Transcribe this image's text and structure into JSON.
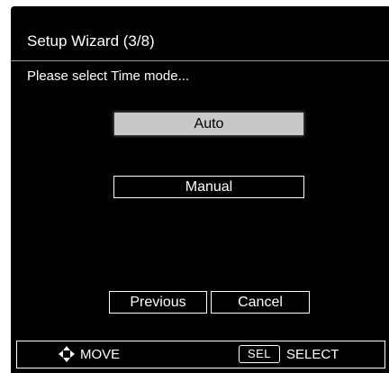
{
  "dialog": {
    "title": "Setup Wizard (3/8)",
    "prompt": "Please select Time mode..."
  },
  "options": {
    "auto": "Auto",
    "manual": "Manual",
    "selected": "Auto"
  },
  "buttons": {
    "previous": "Previous",
    "cancel": "Cancel"
  },
  "hints": {
    "move_icon": "four-way-arrow-icon",
    "move": "MOVE",
    "select_key": "SEL",
    "select": "SELECT"
  },
  "colors": {
    "background": "#000000",
    "text": "#ffffff",
    "selected_fill": "#c8c8c8"
  }
}
